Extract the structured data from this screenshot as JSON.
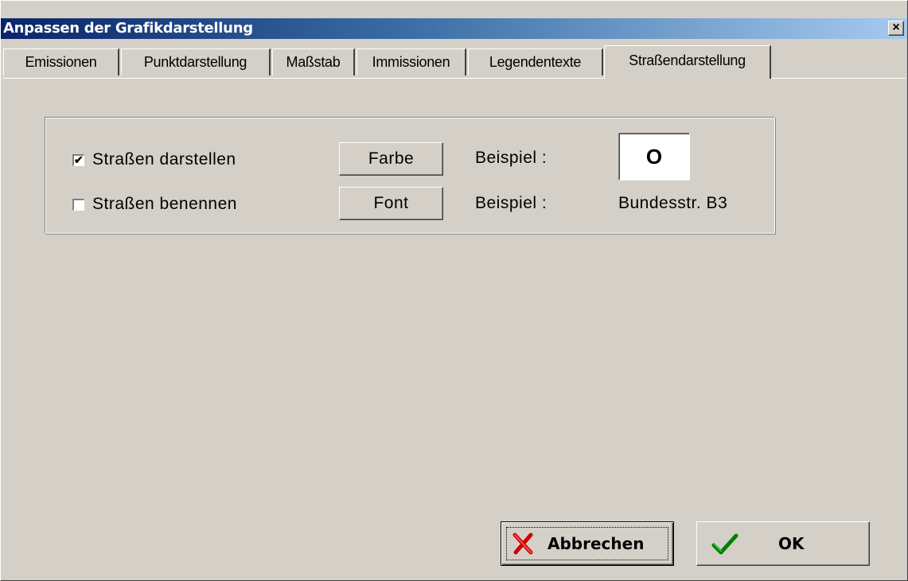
{
  "window": {
    "title": "Anpassen der Grafikdarstellung",
    "close_icon": "close-icon"
  },
  "tabs": [
    {
      "label": "Emissionen"
    },
    {
      "label": "Punktdarstellung"
    },
    {
      "label": "Maßstab"
    },
    {
      "label": "Immissionen"
    },
    {
      "label": "Legendentexte"
    },
    {
      "label": "Straßendarstellung",
      "active": true
    }
  ],
  "settings": {
    "show_roads": {
      "label": "Straßen darstellen",
      "checked": true,
      "check_glyph": "✔"
    },
    "name_roads": {
      "label": "Straßen benennen",
      "checked": false,
      "check_glyph": ""
    },
    "color_button": "Farbe",
    "font_button": "Font",
    "example_label_1": "Beispiel :",
    "example_label_2": "Beispiel :",
    "color_example": "O",
    "font_example": "Bundesstr. B3"
  },
  "buttons": {
    "cancel": {
      "label": "Abbrechen",
      "icon": "x-icon",
      "icon_color": "#cc0000"
    },
    "ok": {
      "label": "OK",
      "icon": "checkmark-icon",
      "icon_color": "#008000"
    }
  }
}
